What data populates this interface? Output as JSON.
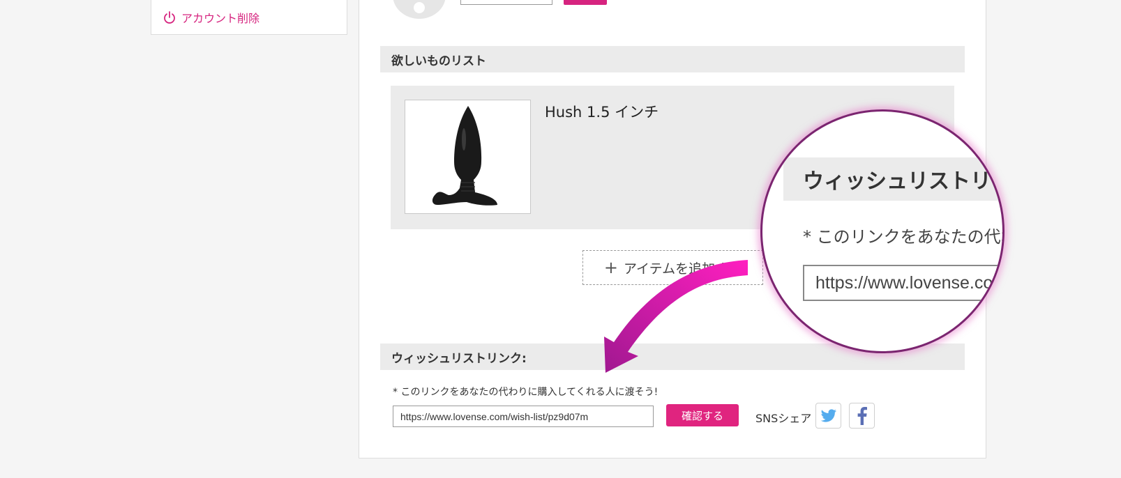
{
  "sidebar": {
    "delete_account_label": "アカウント削除"
  },
  "wishlist": {
    "header": "欲しいものリスト",
    "item": {
      "title": "Hush 1.5 インチ"
    },
    "add_item_label": "アイテムを追加する"
  },
  "wishlist_link": {
    "header": "ウィッシュリストリンク:",
    "note": "* このリンクをあなたの代わりに購入してくれる人に渡そう!",
    "url": "https://www.lovense.com/wish-list/pz9d07m",
    "confirm_label": "確認する",
    "sns_label": "SNSシェア"
  },
  "magnifier": {
    "header": "ウィッシュリストリン",
    "note": "* このリンクをあなたの代わ",
    "url": "https://www.lovense.com"
  },
  "colors": {
    "accent": "#e0247f",
    "header_bg": "#ebebeb",
    "twitter": "#55acee",
    "facebook": "#5b6fb5"
  }
}
